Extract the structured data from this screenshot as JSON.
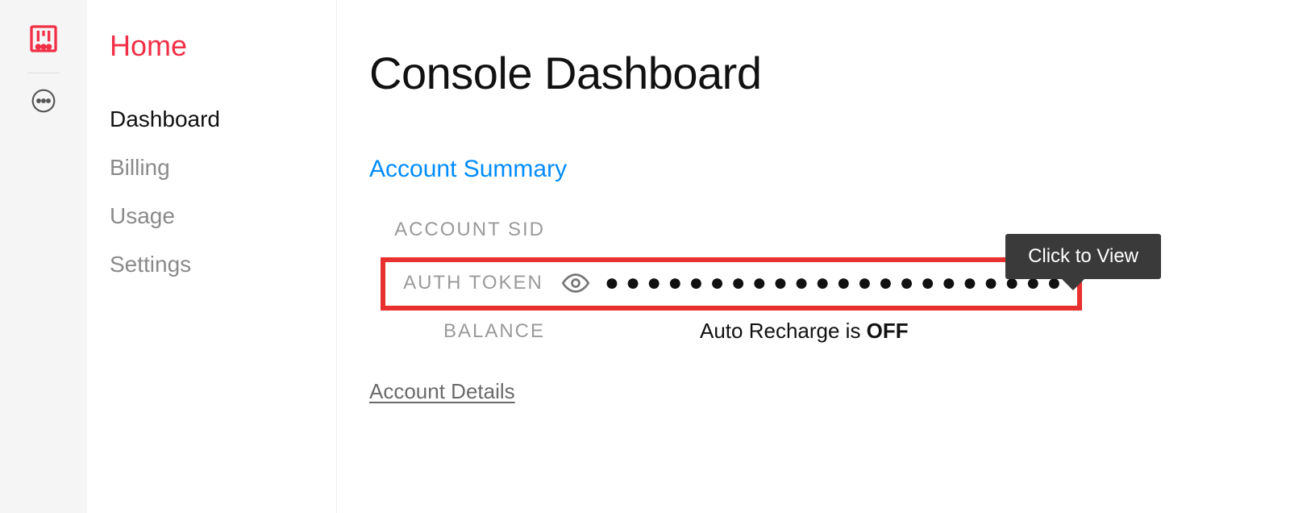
{
  "rail": {
    "icons": [
      "sliders-icon",
      "more-icon"
    ]
  },
  "sidebar": {
    "home_label": "Home",
    "items": [
      {
        "label": "Dashboard",
        "active": true
      },
      {
        "label": "Billing",
        "active": false
      },
      {
        "label": "Usage",
        "active": false
      },
      {
        "label": "Settings",
        "active": false
      }
    ]
  },
  "main": {
    "page_title": "Console Dashboard",
    "section_heading": "Account Summary",
    "labels": {
      "account_sid": "ACCOUNT SID",
      "auth_token": "AUTH TOKEN",
      "balance": "BALANCE"
    },
    "auth_token_masked": "●●●●●●●●●●●●●●●●●●●●●●●",
    "balance_prefix": "Auto Recharge is ",
    "balance_state": "OFF",
    "account_details_link": "Account Details",
    "tooltip": "Click to View"
  },
  "colors": {
    "accent_red": "#f22f46",
    "link_blue": "#008cff",
    "highlight_red": "#e8302f",
    "tooltip_bg": "#3a3a3a"
  }
}
